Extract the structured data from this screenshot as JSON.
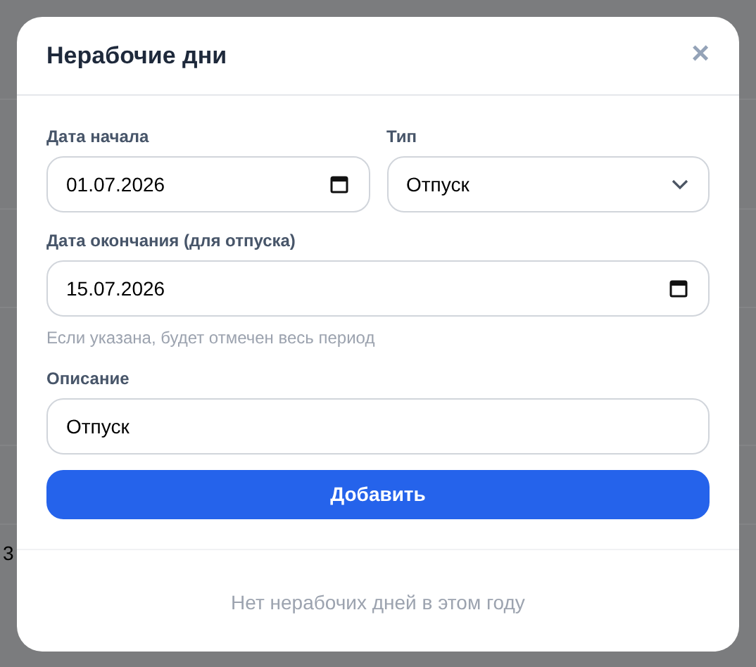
{
  "background": {
    "row_label": "3"
  },
  "dialog": {
    "title": "Нерабочие дни",
    "close": "×",
    "fields": [
      {
        "kind": "date",
        "label": "Дата начала",
        "value": "01.07.2026"
      },
      {
        "kind": "select",
        "label": "Тип",
        "value": "Отпуск"
      },
      {
        "kind": "date",
        "label": "Дата окончания (для отпуска)",
        "value": "15.07.2026",
        "hint": "Если указана, будет отмечен весь период"
      },
      {
        "kind": "text",
        "label": "Описание",
        "value": "Отпуск"
      }
    ],
    "submit_button": "Добавить",
    "empty_message": "Нет нерабочих дней в этом году"
  }
}
